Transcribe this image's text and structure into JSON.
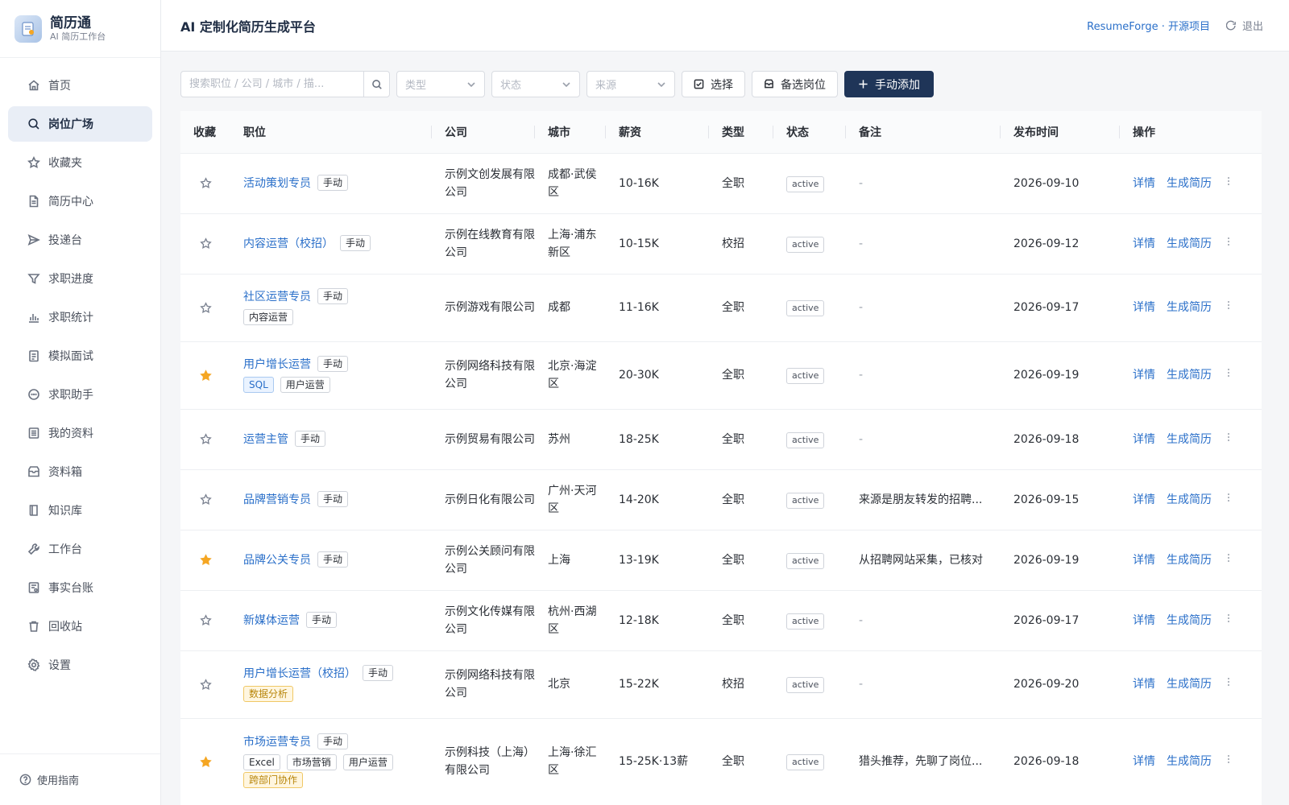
{
  "brand": {
    "title": "简历通",
    "subtitle": "AI 简历工作台"
  },
  "nav": {
    "items": [
      {
        "label": "首页",
        "icon": "home-icon"
      },
      {
        "label": "岗位广场",
        "icon": "search-icon",
        "active": true
      },
      {
        "label": "收藏夹",
        "icon": "star-icon"
      },
      {
        "label": "简历中心",
        "icon": "document-icon"
      },
      {
        "label": "投递台",
        "icon": "send-icon"
      },
      {
        "label": "求职进度",
        "icon": "funnel-icon"
      },
      {
        "label": "求职统计",
        "icon": "bar-chart-icon"
      },
      {
        "label": "模拟面试",
        "icon": "clipboard-icon"
      },
      {
        "label": "求职助手",
        "icon": "chat-icon"
      },
      {
        "label": "我的资料",
        "icon": "profile-icon"
      },
      {
        "label": "资料箱",
        "icon": "inbox-icon"
      },
      {
        "label": "知识库",
        "icon": "book-icon"
      },
      {
        "label": "工作台",
        "icon": "wrench-icon"
      },
      {
        "label": "事实台账",
        "icon": "ledger-icon"
      },
      {
        "label": "回收站",
        "icon": "trash-icon"
      },
      {
        "label": "设置",
        "icon": "gear-icon"
      }
    ],
    "guide": "使用指南"
  },
  "header": {
    "title": "AI 定制化简历生成平台",
    "project_link": "ResumeForge · 开源项目",
    "logout": "退出"
  },
  "toolbar": {
    "search_placeholder": "搜索职位 / 公司 / 城市 / 描...",
    "type_placeholder": "类型",
    "status_placeholder": "状态",
    "source_placeholder": "来源",
    "select_label": "选择",
    "shortlist_label": "备选岗位",
    "add_label": "手动添加"
  },
  "table": {
    "columns": [
      "收藏",
      "职位",
      "公司",
      "城市",
      "薪资",
      "类型",
      "状态",
      "备注",
      "发布时间",
      "操作"
    ],
    "detail_label": "详情",
    "generate_label": "生成简历",
    "rows": [
      {
        "fav": false,
        "title": "活动策划专员",
        "source": "手动",
        "tags": [],
        "company": "示例文创发展有限公司",
        "city": "成都·武侯区",
        "salary": "10-16K",
        "type": "全职",
        "status": "active",
        "note": "-",
        "date": "2026-09-10"
      },
      {
        "fav": false,
        "title": "内容运营（校招）",
        "source": "手动",
        "tags": [],
        "company": "示例在线教育有限公司",
        "city": "上海·浦东新区",
        "salary": "10-15K",
        "type": "校招",
        "status": "active",
        "note": "-",
        "date": "2026-09-12"
      },
      {
        "fav": false,
        "title": "社区运营专员",
        "source": "手动",
        "tags": [
          {
            "text": "内容运营",
            "style": "plain"
          }
        ],
        "company": "示例游戏有限公司",
        "city": "成都",
        "salary": "11-16K",
        "type": "全职",
        "status": "active",
        "note": "-",
        "date": "2026-09-17"
      },
      {
        "fav": true,
        "title": "用户增长运营",
        "source": "手动",
        "tags": [
          {
            "text": "SQL",
            "style": "blue"
          },
          {
            "text": "用户运营",
            "style": "plain"
          }
        ],
        "company": "示例网络科技有限公司",
        "city": "北京·海淀区",
        "salary": "20-30K",
        "type": "全职",
        "status": "active",
        "note": "-",
        "date": "2026-09-19"
      },
      {
        "fav": false,
        "title": "运营主管",
        "source": "手动",
        "tags": [],
        "company": "示例贸易有限公司",
        "city": "苏州",
        "salary": "18-25K",
        "type": "全职",
        "status": "active",
        "note": "-",
        "date": "2026-09-18"
      },
      {
        "fav": false,
        "title": "品牌营销专员",
        "source": "手动",
        "tags": [],
        "company": "示例日化有限公司",
        "city": "广州·天河区",
        "salary": "14-20K",
        "type": "全职",
        "status": "active",
        "note": "来源是朋友转发的招聘...",
        "date": "2026-09-15"
      },
      {
        "fav": true,
        "title": "品牌公关专员",
        "source": "手动",
        "tags": [],
        "company": "示例公关顾问有限公司",
        "city": "上海",
        "salary": "13-19K",
        "type": "全职",
        "status": "active",
        "note": "从招聘网站采集，已核对",
        "date": "2026-09-19"
      },
      {
        "fav": false,
        "title": "新媒体运营",
        "source": "手动",
        "tags": [],
        "company": "示例文化传媒有限公司",
        "city": "杭州·西湖区",
        "salary": "12-18K",
        "type": "全职",
        "status": "active",
        "note": "-",
        "date": "2026-09-17"
      },
      {
        "fav": false,
        "title": "用户增长运营（校招）",
        "source": "手动",
        "tags": [
          {
            "text": "数据分析",
            "style": "yellow"
          }
        ],
        "company": "示例网络科技有限公司",
        "city": "北京",
        "salary": "15-22K",
        "type": "校招",
        "status": "active",
        "note": "-",
        "date": "2026-09-20"
      },
      {
        "fav": true,
        "title": "市场运营专员",
        "source": "手动",
        "tags": [
          {
            "text": "Excel",
            "style": "plain"
          },
          {
            "text": "市场营销",
            "style": "plain"
          },
          {
            "text": "用户运营",
            "style": "plain"
          },
          {
            "text": "跨部门协作",
            "style": "yellow"
          }
        ],
        "company": "示例科技（上海）有限公司",
        "city": "上海·徐汇区",
        "salary": "15-25K·13薪",
        "type": "全职",
        "status": "active",
        "note": "猎头推荐，先聊了岗位...",
        "date": "2026-09-18"
      }
    ]
  },
  "colors": {
    "accent": "#2a6fc9",
    "primary_button": "#1f3558",
    "star_on": "#f5a623"
  }
}
